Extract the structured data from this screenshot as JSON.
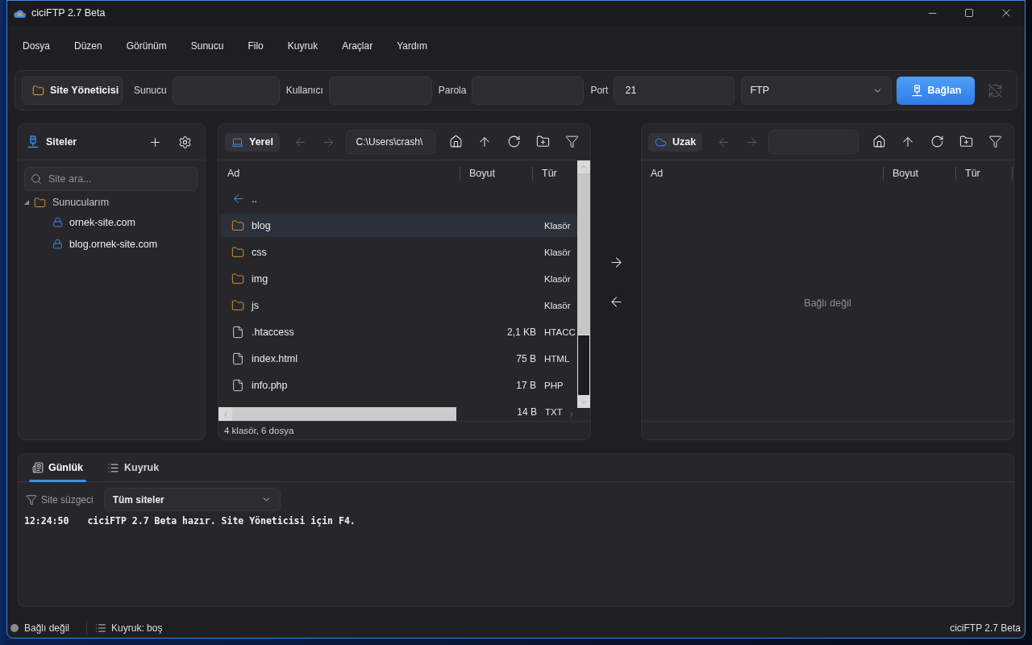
{
  "window": {
    "title": "ciciFTP 2.7 Beta"
  },
  "menu": [
    "Dosya",
    "Düzen",
    "Görünüm",
    "Sunucu",
    "Filo",
    "Kuyruk",
    "Araçlar",
    "Yardım"
  ],
  "connect_bar": {
    "site_manager": "Site Yöneticisi",
    "fields": [
      {
        "kind": "host",
        "label": "Sunucu"
      },
      {
        "kind": "user",
        "label": "Kullanıcı"
      },
      {
        "kind": "password",
        "label": "Parola"
      },
      {
        "kind": "port",
        "label": "Port",
        "value": "21"
      }
    ],
    "protocol": "FTP",
    "connect": "Bağlan",
    "disconnect_disabled": true
  },
  "sites": {
    "title": "Siteler",
    "search": {
      "placeholder": "Site ara..."
    },
    "tree": [
      {
        "kind": "folder",
        "label": "Sunucularım",
        "expanded": true,
        "children": [
          {
            "kind": "site",
            "label": "ornek-site.com"
          },
          {
            "kind": "site",
            "label": "blog.ornek-site.com"
          }
        ]
      }
    ]
  },
  "local": {
    "label": "Yerel",
    "back_disabled": true,
    "forward_disabled": true,
    "path": "C:\\Users\\crash\\",
    "columns": [
      "Ad",
      "Boyut",
      "Tür"
    ],
    "rows": [
      {
        "kind": "parent",
        "name": "..",
        "selected": false
      },
      {
        "kind": "folder",
        "name": "blog",
        "type": "Klasör",
        "selected": true
      },
      {
        "kind": "folder",
        "name": "css",
        "type": "Klasör",
        "selected": false
      },
      {
        "kind": "folder",
        "name": "img",
        "type": "Klasör",
        "selected": false
      },
      {
        "kind": "folder",
        "name": "js",
        "type": "Klasör",
        "selected": false
      },
      {
        "kind": "file",
        "name": ".htaccess",
        "size": "2,1 KB",
        "type": "HTACC",
        "selected": false
      },
      {
        "kind": "file",
        "name": "index.html",
        "size": "75 B",
        "type": "HTML",
        "selected": false
      },
      {
        "kind": "file",
        "name": "info.php",
        "size": "17 B",
        "type": "PHP",
        "selected": false
      },
      {
        "size": "14 B",
        "type": "TXT",
        "selected": false
      }
    ],
    "status": "4 klasör, 6 dosya"
  },
  "remote": {
    "label": "Uzak",
    "back_disabled": true,
    "forward_disabled": true,
    "columns": [
      "Ad",
      "Boyut",
      "Tür"
    ],
    "message": "Bağlı değil"
  },
  "log": {
    "tabs": [
      {
        "kind": "log",
        "label": "Günlük",
        "selected": true
      },
      {
        "kind": "queue",
        "label": "Kuyruk",
        "selected": false
      }
    ],
    "filter_label": "Site süzgeci",
    "filter_value": "Tüm siteler",
    "entries": [
      {
        "time": "12:24:50",
        "message": "ciciFTP 2.7 Beta hazır. Site Yöneticisi için F4."
      }
    ]
  },
  "status_bar": {
    "connected": false,
    "connection": "Bağlı değil",
    "queue": "Kuyruk: boş",
    "version": "ciciFTP 2.7 Beta"
  }
}
